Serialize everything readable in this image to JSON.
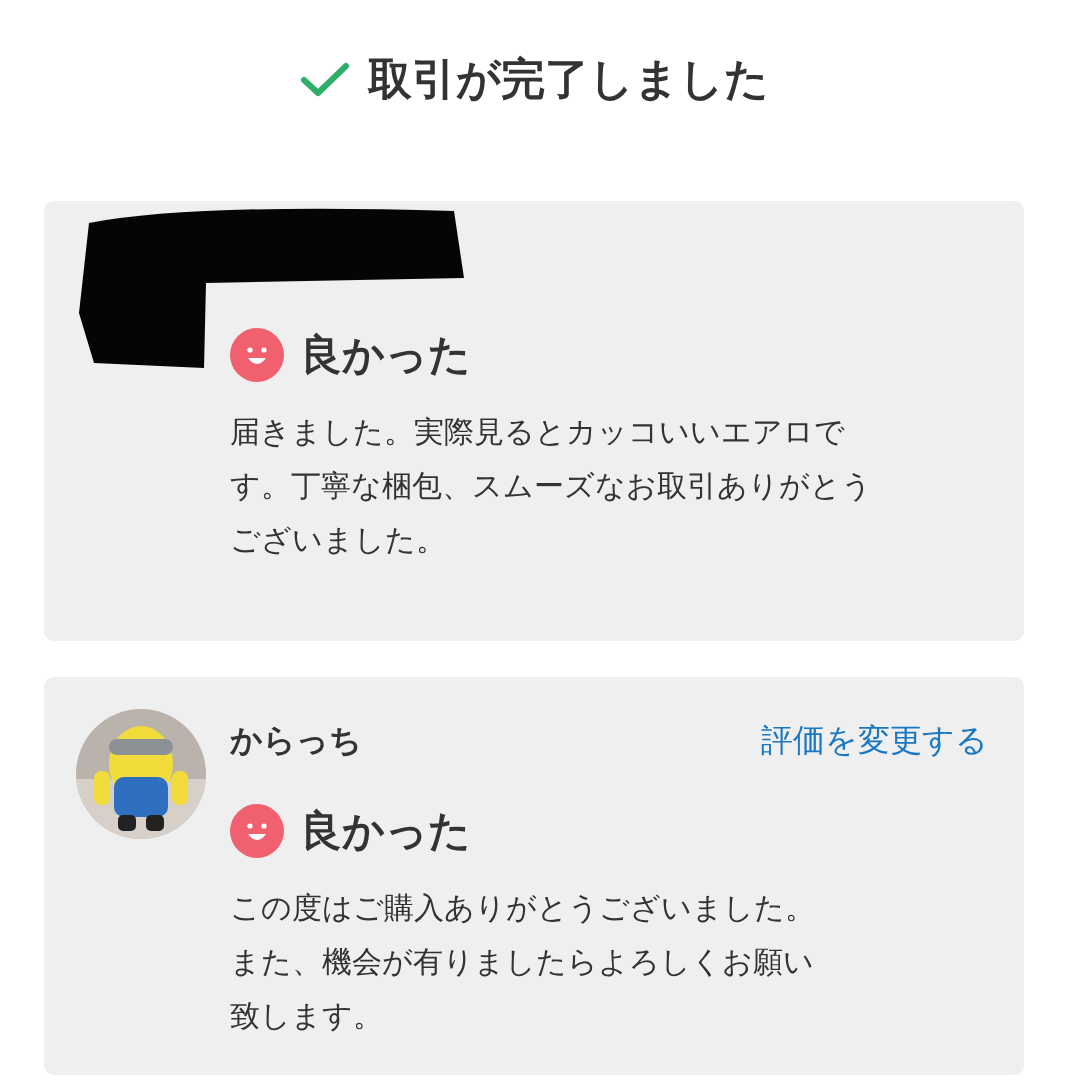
{
  "header": {
    "title": "取引が完了しました"
  },
  "reviews": [
    {
      "redacted": true,
      "rating": {
        "kind": "good",
        "label": "良かった"
      },
      "comment_lines": [
        "届きました。実際見るとカッコいいエアロで",
        "す。丁寧な梱包、スムーズなお取引ありがとう",
        "ございました。"
      ]
    },
    {
      "redacted": false,
      "user_name": "からっち",
      "change_link": "評価を変更する",
      "rating": {
        "kind": "good",
        "label": "良かった"
      },
      "comment_lines": [
        "この度はご購入ありがとうございました。",
        "また、機会が有りましたらよろしくお願い",
        "致します。"
      ]
    }
  ]
}
